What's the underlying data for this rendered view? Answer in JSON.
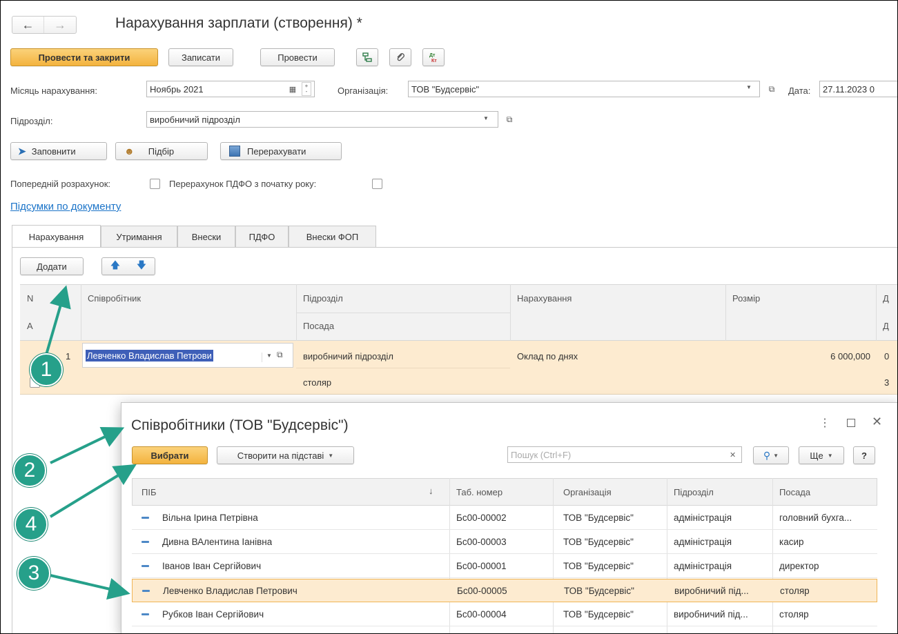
{
  "window": {
    "title": "Нарахування зарплати (створення) *"
  },
  "toolbar": {
    "post_close": "Провести та закрити",
    "save": "Записати",
    "post": "Провести"
  },
  "form": {
    "month_label": "Місяць нарахування:",
    "month_value": "Ноябрь 2021",
    "org_label": "Організація:",
    "org_value": "ТОВ \"Будсервіс\"",
    "date_label": "Дата:",
    "date_value": "27.11.2023 0",
    "dept_label": "Підрозділ:",
    "dept_value": "виробничий підрозділ"
  },
  "actions": {
    "fill": "Заповнити",
    "pick": "Підбір",
    "recalc": "Перерахувати"
  },
  "options": {
    "prelim_label": "Попередній розрахунок:",
    "ndfl_label": "Перерахунок ПДФО з початку року:"
  },
  "totals_link": "Підсумки по документу",
  "tabs": [
    "Нарахування",
    "Утримання",
    "Внески",
    "ПДФО",
    "Внески ФОП"
  ],
  "table_toolbar": {
    "add": "Додати"
  },
  "grid": {
    "h_n": "N",
    "h_a": "А",
    "h_employee": "Співробітник",
    "h_dept": "Підрозділ",
    "h_position": "Посада",
    "h_accrual": "Нарахування",
    "h_amount": "Розмір",
    "h_d1": "Д",
    "h_d2": "Д",
    "row": {
      "n": "1",
      "employee": "Левченко Владислав Петрови",
      "dept": "виробничий підрозділ",
      "position": "столяр",
      "accrual": "Оклад по днях",
      "amount": "6 000,000",
      "d1": "0",
      "d2": "3"
    }
  },
  "popup": {
    "title": "Співробітники (ТОВ \"Будсервіс\")",
    "select": "Вибрати",
    "create_based": "Створити на підставі",
    "search_placeholder": "Пошук (Ctrl+F)",
    "more": "Ще",
    "help": "?",
    "columns": [
      "ПІБ",
      "Таб. номер",
      "Організація",
      "Підрозділ",
      "Посада"
    ],
    "rows": [
      {
        "name": "Вільна Ірина Петрівна",
        "tab": "Бс00-00002",
        "org": "ТОВ \"Будсервіс\"",
        "dept": "адміністрація",
        "pos": "головний бухга..."
      },
      {
        "name": "Дивна ВАлентина Іанівна",
        "tab": "Бс00-00003",
        "org": "ТОВ \"Будсервіс\"",
        "dept": "адміністрація",
        "pos": "касир"
      },
      {
        "name": "Іванов Іван Сергійович",
        "tab": "Бс00-00001",
        "org": "ТОВ \"Будсервіс\"",
        "dept": "адміністрація",
        "pos": "директор"
      },
      {
        "name": "Левченко Владислав Петрович",
        "tab": "Бс00-00005",
        "org": "ТОВ \"Будсервіс\"",
        "dept": "виробничий під...",
        "pos": "столяр"
      },
      {
        "name": "Рубков Іван Сергійович",
        "tab": "Бс00-00004",
        "org": "ТОВ \"Будсервіс\"",
        "dept": "виробничий під...",
        "pos": "столяр"
      }
    ]
  },
  "markers": [
    "1",
    "2",
    "3",
    "4"
  ],
  "colors": {
    "accent": "#f3b33e",
    "marker": "#26a08a",
    "link": "#1a73c8",
    "selection": "#fdebd0"
  }
}
